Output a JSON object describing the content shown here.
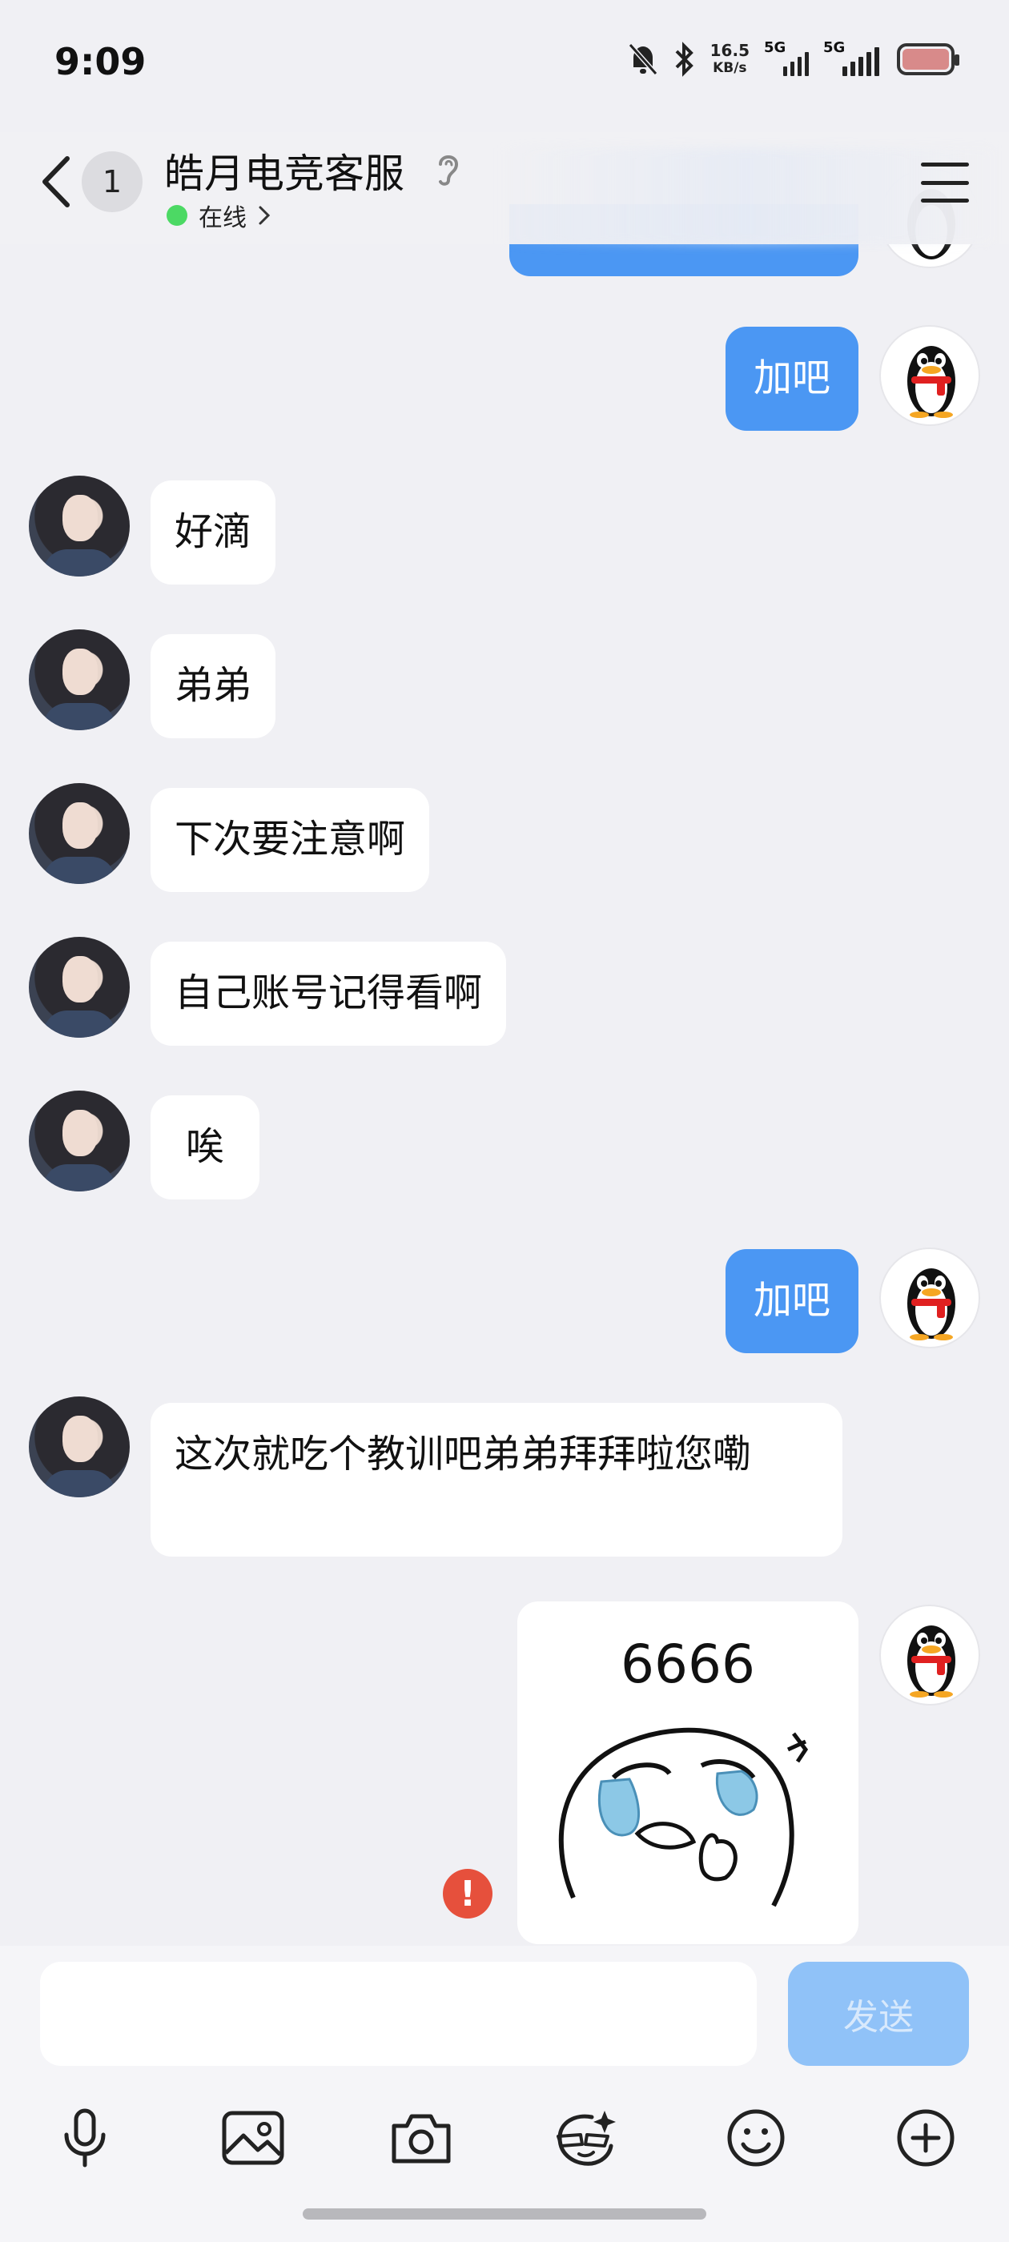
{
  "status_bar": {
    "time": "9:09",
    "net_speed_value": "16.5",
    "net_speed_unit": "KB/s",
    "sim1_label": "5G",
    "sim2_label": "5G"
  },
  "header": {
    "unread_count": "1",
    "title": "皓月电竞客服",
    "online_status": "在线",
    "online_color": "#4cd964"
  },
  "messages": [
    {
      "side": "right",
      "text": "加吧"
    },
    {
      "side": "left",
      "text": "好滴"
    },
    {
      "side": "left",
      "text": "弟弟"
    },
    {
      "side": "left",
      "text": "下次要注意啊"
    },
    {
      "side": "left",
      "text": "自己账号记得看啊"
    },
    {
      "side": "left",
      "text": "唉"
    },
    {
      "side": "right",
      "text": "加吧"
    },
    {
      "side": "left",
      "text": "这次就吃个教训吧弟弟拜拜啦您嘞"
    },
    {
      "side": "right",
      "type": "sticker",
      "text": "6666",
      "send_status": "failed"
    }
  ],
  "input": {
    "placeholder": "",
    "value": "",
    "send_label": "发送"
  },
  "toolbar": {
    "icons": [
      "microphone-icon",
      "image-icon",
      "camera-icon",
      "ai-face-icon",
      "emoji-icon",
      "plus-icon"
    ]
  },
  "colors": {
    "bubble_right": "#4b97f3",
    "bubble_left": "#ffffff",
    "background": "#f0f0f4",
    "send_button_disabled": "#90c2f8",
    "error": "#e6503c"
  }
}
